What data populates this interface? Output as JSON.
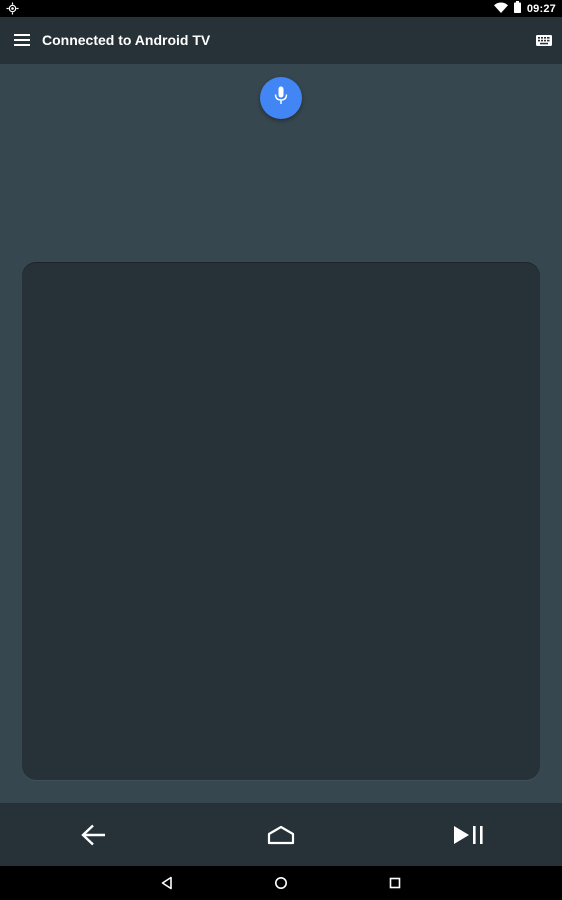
{
  "status_bar": {
    "time": "09:27",
    "icons": [
      "gps-icon",
      "wifi-icon",
      "battery-icon"
    ]
  },
  "toolbar": {
    "title": "Connected to Android TV",
    "menu_icon": "menu-icon",
    "keyboard_icon": "keyboard-icon"
  },
  "mic": {
    "icon": "microphone-icon",
    "color": "#4285f4"
  },
  "touchpad": {
    "color": "#263238"
  },
  "controls": {
    "items": [
      "back-arrow-icon",
      "home-icon",
      "play-pause-icon"
    ]
  },
  "navigation_bar": {
    "items": [
      "nav-back-icon",
      "nav-home-icon",
      "nav-recents-icon"
    ]
  },
  "colors": {
    "background": "#37474f",
    "toolbar": "#263238",
    "accent": "#4285f4"
  }
}
